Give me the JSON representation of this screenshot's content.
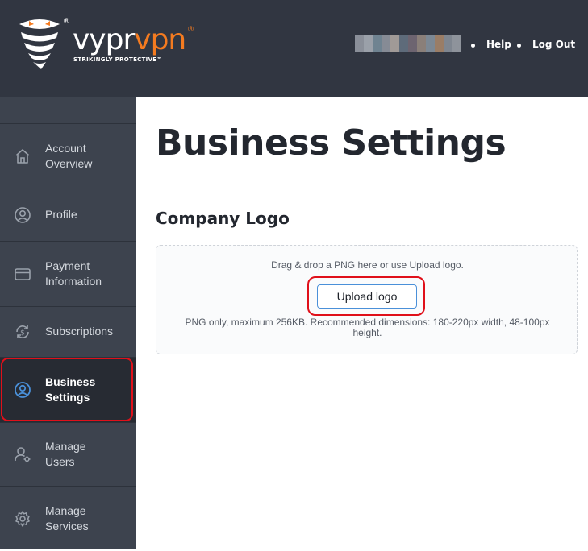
{
  "header": {
    "logo": {
      "word_part1": "vypr",
      "word_part2": "vpn",
      "registered": "®",
      "tagline": "STRIKINGLY PROTECTIVE™",
      "brand_color": "#f47b20"
    },
    "help_label": "Help",
    "logout_label": "Log Out"
  },
  "sidebar": {
    "items": [
      {
        "label_lines": [
          "Account",
          "Overview"
        ],
        "icon": "home-icon"
      },
      {
        "label_lines": [
          "Profile"
        ],
        "icon": "user-circle-icon"
      },
      {
        "label_lines": [
          "Payment",
          "Information"
        ],
        "icon": "credit-card-icon"
      },
      {
        "label_lines": [
          "Subscriptions"
        ],
        "icon": "refresh-dollar-icon"
      },
      {
        "label_lines": [
          "Business",
          "Settings"
        ],
        "icon": "user-circle-icon",
        "active": true
      },
      {
        "label_lines": [
          "Manage",
          "Users"
        ],
        "icon": "user-gear-icon"
      },
      {
        "label_lines": [
          "Manage",
          "Services"
        ],
        "icon": "gear-icon"
      }
    ]
  },
  "main": {
    "title": "Business Settings",
    "company_logo": {
      "heading": "Company Logo",
      "drop_hint": "Drag & drop a PNG here or use Upload logo.",
      "upload_button": "Upload logo",
      "requirements": "PNG only, maximum 256KB. Recommended dimensions: 180-220px width, 48-100px height."
    }
  },
  "colors": {
    "header_bg": "#313641",
    "sidebar_bg": "#3d434e",
    "sidebar_active_bg": "#272b33",
    "highlight": "#e0101a",
    "accent_blue": "#4a90d9"
  }
}
